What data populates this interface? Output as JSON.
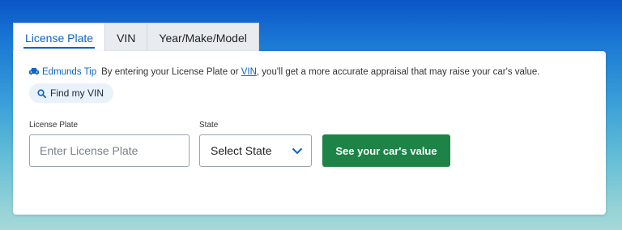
{
  "tabs": [
    {
      "label": "License Plate",
      "active": true
    },
    {
      "label": "VIN",
      "active": false
    },
    {
      "label": "Year/Make/Model",
      "active": false
    }
  ],
  "tip": {
    "icon": "car-icon",
    "label": "Edmunds Tip",
    "text_before": "By entering your License Plate or ",
    "link": "VIN",
    "text_after": ", you'll get a more accurate appraisal that may raise your car's value."
  },
  "find_vin": {
    "icon": "search-icon",
    "label": "Find my VIN"
  },
  "form": {
    "plate_label": "License Plate",
    "plate_placeholder": "Enter License Plate",
    "state_label": "State",
    "state_value": "Select State",
    "submit_label": "See your car's value"
  },
  "colors": {
    "accent": "#0b62c9",
    "cta": "#1d8347"
  }
}
